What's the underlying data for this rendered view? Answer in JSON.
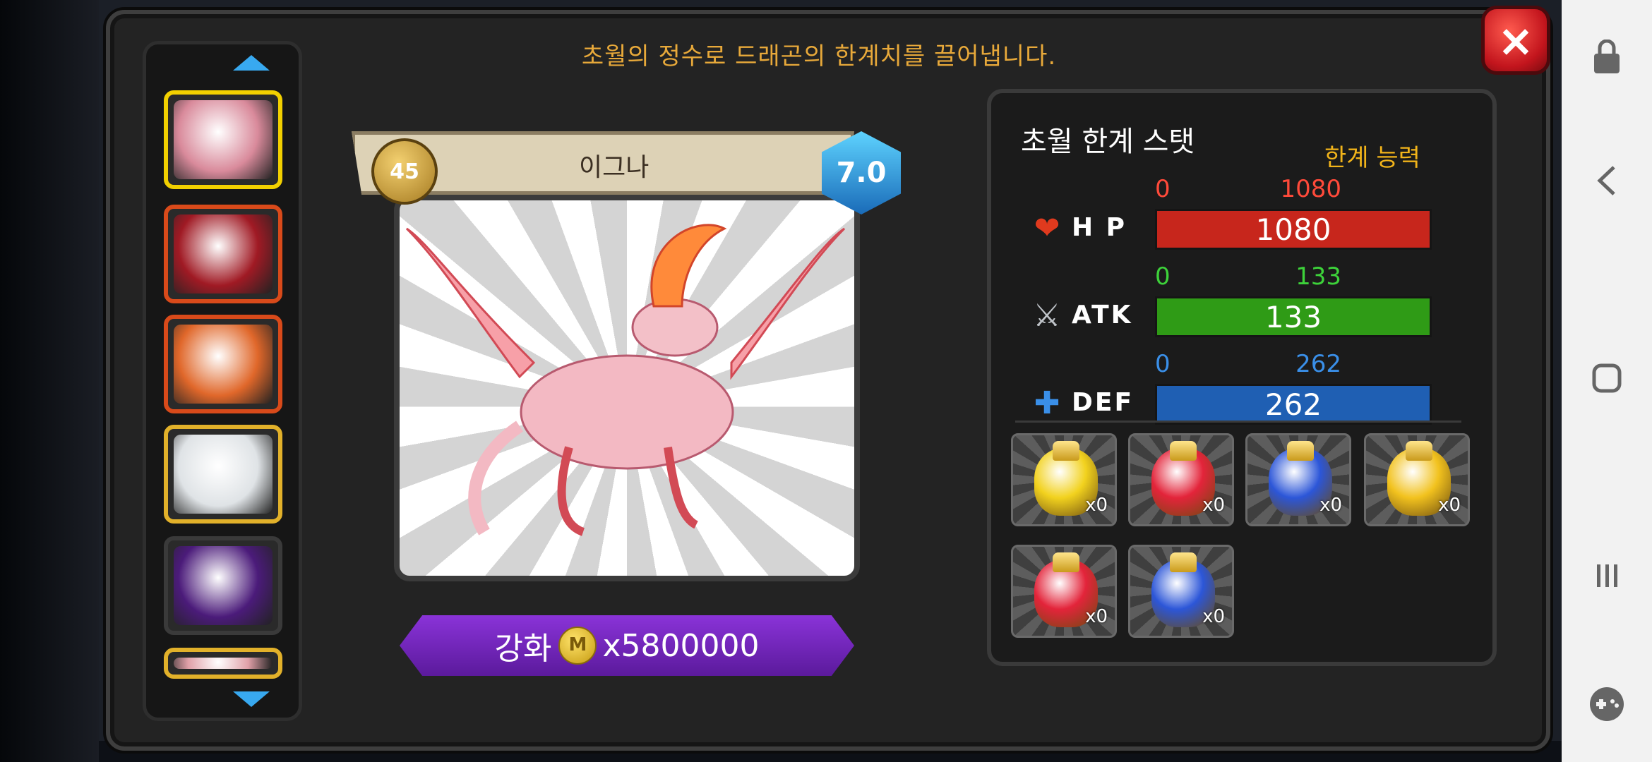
{
  "headline": "초월의 정수로 드래곤의 한계치를 끌어냅니다.",
  "close_icon": "×",
  "dragon": {
    "name": "이그나",
    "level": "45",
    "grade": "7.0"
  },
  "enhance": {
    "label": "강화",
    "coin_symbol": "M",
    "amount": "x5800000"
  },
  "stats": {
    "title": "초월 한계 스탯",
    "subtitle": "한계 능력",
    "rows": [
      {
        "label": "H P",
        "min": "0",
        "max": "1080",
        "value": "1080",
        "color": "#c7261c",
        "text_color": "#ff4a3a",
        "fill": 1.0
      },
      {
        "label": "ATK",
        "min": "0",
        "max": "133",
        "value": "133",
        "color": "#2f9b16",
        "text_color": "#3dd23a",
        "fill": 1.0
      },
      {
        "label": "DEF",
        "min": "0",
        "max": "262",
        "value": "262",
        "color": "#1f5fb3",
        "text_color": "#3a8fe8",
        "fill": 1.0
      }
    ]
  },
  "items": [
    {
      "qty": "x0",
      "color": "#f2d21e"
    },
    {
      "qty": "x0",
      "color": "#e3243a"
    },
    {
      "qty": "x0",
      "color": "#2c56d8"
    },
    {
      "qty": "x0",
      "color": "#f2c21e"
    },
    {
      "qty": "x0",
      "color": "#e3243a"
    },
    {
      "qty": "x0",
      "color": "#2c56d8"
    }
  ],
  "roster": [
    {
      "color": "#d98a9b",
      "border": "#f2d000"
    },
    {
      "color": "#a01a24",
      "border": "#d94a1a"
    },
    {
      "color": "#e0672a",
      "border": "#d94a1a"
    },
    {
      "color": "#dfe3e6",
      "border": "#e2b12a"
    },
    {
      "color": "#4b1b7a",
      "border": "#3a3a3a"
    },
    {
      "color": "#e0a0a8",
      "border": "#e2b12a"
    }
  ],
  "nav_icons": [
    "lock-icon",
    "back-icon",
    "home-icon",
    "recents-icon",
    "game-icon"
  ]
}
